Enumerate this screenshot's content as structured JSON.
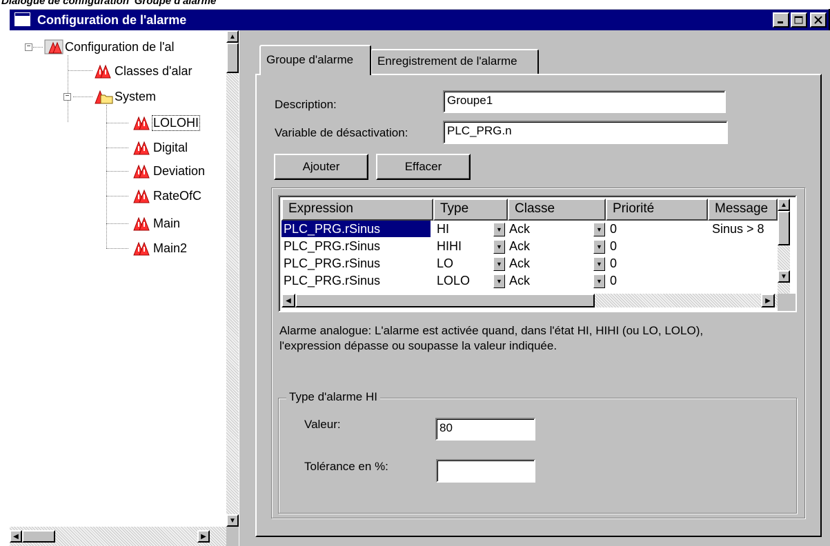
{
  "caption": "Dialogue de configuration 'Groupe d'alarme'",
  "window": {
    "title": "Configuration de l'alarme",
    "controls": {
      "minimize_icon": "minimize-icon",
      "maximize_icon": "maximize-icon",
      "close_icon": "close-icon"
    }
  },
  "tree": {
    "root": "Configuration de l'al",
    "items": [
      {
        "label": "Classes d'alar"
      },
      {
        "label": "System"
      },
      {
        "label": "LOLOHI"
      },
      {
        "label": "Digital"
      },
      {
        "label": "Deviation"
      },
      {
        "label": "RateOfC"
      },
      {
        "label": "Main"
      },
      {
        "label": "Main2"
      }
    ]
  },
  "tabs": [
    {
      "label": "Groupe d'alarme",
      "active": true
    },
    {
      "label": "Enregistrement de l'alarme",
      "active": false
    }
  ],
  "form": {
    "description_label": "Description:",
    "description_value": "Groupe1",
    "deactivation_label": "Variable de désactivation:",
    "deactivation_value": "PLC_PRG.n",
    "add_label": "Ajouter",
    "delete_label": "Effacer"
  },
  "grid": {
    "columns": [
      "Expression",
      "Type",
      "Classe",
      "Priorité",
      "Message"
    ],
    "rows": [
      {
        "expression": "PLC_PRG.rSinus",
        "type": "HI",
        "classe": "Ack",
        "priorite": "0",
        "message": "Sinus > 8"
      },
      {
        "expression": "PLC_PRG.rSinus",
        "type": "HIHI",
        "classe": "Ack",
        "priorite": "0",
        "message": ""
      },
      {
        "expression": "PLC_PRG.rSinus",
        "type": "LO",
        "classe": "Ack",
        "priorite": "0",
        "message": ""
      },
      {
        "expression": "PLC_PRG.rSinus",
        "type": "LOLO",
        "classe": "Ack",
        "priorite": "0",
        "message": ""
      }
    ]
  },
  "info": {
    "line1": "Alarme analogue: L'alarme est activée quand, dans l'état HI, HIHI (ou LO, LOLO),",
    "line2": "l'expression dépasse ou soupasse la valeur indiquée."
  },
  "alarm_type": {
    "group_label": "Type d'alarme HI",
    "value_label": "Valeur:",
    "value": "80",
    "tolerance_label": "Tolérance en %:",
    "tolerance_value": ""
  },
  "colors": {
    "titlebar": "#000080",
    "face": "#c0c0c0",
    "selection": "#000080",
    "alarm_red": "#e00000"
  }
}
